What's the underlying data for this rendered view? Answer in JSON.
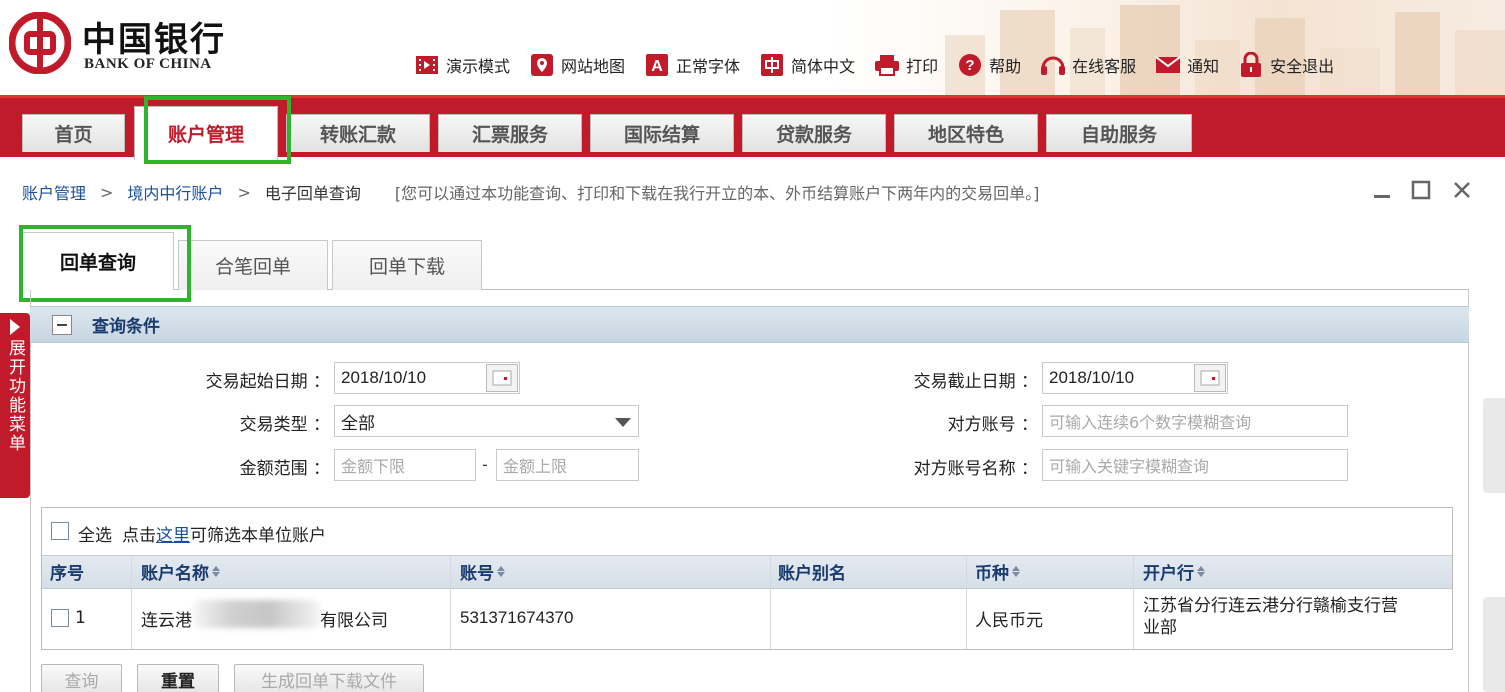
{
  "header": {
    "logo_cn": "中国银行",
    "logo_en": "BANK OF CHINA",
    "toplinks": [
      {
        "label": "演示模式",
        "icon": "demo-film-icon"
      },
      {
        "label": "网站地图",
        "icon": "map-pin-icon"
      },
      {
        "label": "正常字体",
        "icon": "font-a-icon"
      },
      {
        "label": "简体中文",
        "icon": "chinese-zhong-icon"
      },
      {
        "label": "打印",
        "icon": "printer-icon"
      },
      {
        "label": "帮助",
        "icon": "help-icon"
      },
      {
        "label": "在线客服",
        "icon": "headset-icon"
      },
      {
        "label": "通知",
        "icon": "envelope-icon"
      },
      {
        "label": "安全退出",
        "icon": "lock-icon"
      }
    ],
    "colors": {
      "brand_red": "#c11a2a",
      "highlight_green": "#2fb52b"
    }
  },
  "nav": {
    "tabs": [
      "首页",
      "账户管理",
      "转账汇款",
      "汇票服务",
      "国际结算",
      "贷款服务",
      "地区特色",
      "自助服务"
    ],
    "active": "账户管理"
  },
  "breadcrumb": {
    "items": [
      "账户管理",
      "境内中行账户",
      "电子回单查询"
    ],
    "separator": ">",
    "note": "[您可以通过本功能查询、打印和下载在我行开立的本、外币结算账户下两年内的交易回单。]"
  },
  "subtabs": {
    "items": [
      "回单查询",
      "合笔回单",
      "回单下载"
    ],
    "active": "回单查询"
  },
  "side_menu": {
    "label": "展开功能菜单"
  },
  "query": {
    "title": "查询条件",
    "start_date": {
      "label": "交易起始日期 ：",
      "value": "2018/10/10"
    },
    "end_date": {
      "label": "交易截止日期 ：",
      "value": "2018/10/10"
    },
    "txn_type": {
      "label": "交易类型 ：",
      "value": "全部"
    },
    "counter_account": {
      "label": "对方账号 ：",
      "placeholder": "可输入连续6个数字模糊查询"
    },
    "amount_range": {
      "label": "金额范围 ：",
      "min_placeholder": "金额下限",
      "max_placeholder": "金额上限",
      "dash": "-"
    },
    "counter_name": {
      "label": "对方账号名称 ：",
      "placeholder": "可输入关键字模糊查询"
    }
  },
  "account_table": {
    "select_all": "全选",
    "filter_prefix": "点击",
    "filter_link": "这里",
    "filter_suffix": "可筛选本单位账户",
    "columns": [
      "序号",
      "账户名称",
      "账号",
      "账户别名",
      "币种",
      "开户行"
    ],
    "rows": [
      {
        "no": "1",
        "name_start": "连云港",
        "name_end": "有限公司",
        "account": "531371674370",
        "alias": "",
        "currency": "人民币元",
        "branch_line1": "江苏省分行连云港分行赣榆支行营",
        "branch_line2": "业部"
      }
    ]
  },
  "buttons": {
    "query": "查询",
    "reset": "重置",
    "generate": "生成回单下载文件"
  }
}
